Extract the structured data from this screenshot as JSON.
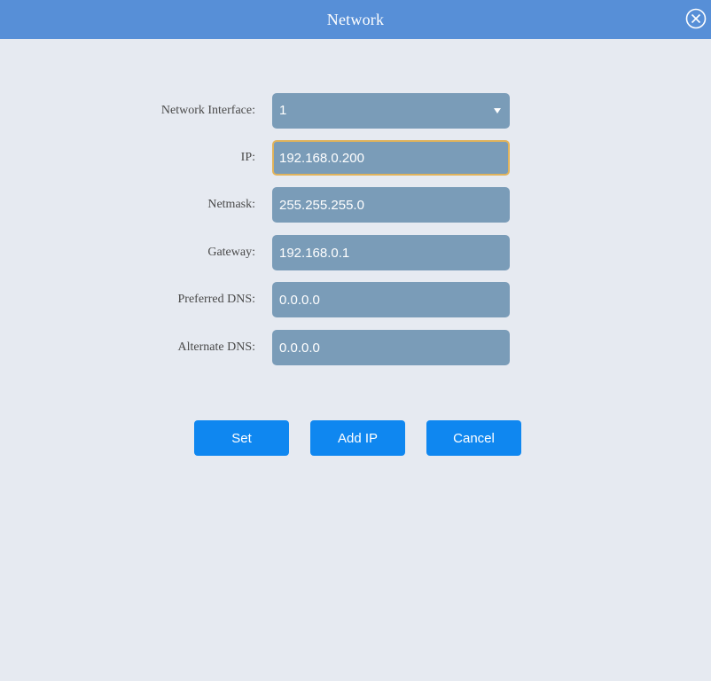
{
  "dialog": {
    "title": "Network"
  },
  "form": {
    "interface": {
      "label": "Network Interface:",
      "value": "1"
    },
    "ip": {
      "label": "IP:",
      "value": "192.168.0.200"
    },
    "netmask": {
      "label": "Netmask:",
      "value": "255.255.255.0"
    },
    "gateway": {
      "label": "Gateway:",
      "value": "192.168.0.1"
    },
    "preferred_dns": {
      "label": "Preferred DNS:",
      "value": "0.0.0.0"
    },
    "alternate_dns": {
      "label": "Alternate DNS:",
      "value": "0.0.0.0"
    }
  },
  "buttons": {
    "set": "Set",
    "add_ip": "Add IP",
    "cancel": "Cancel"
  },
  "icons": {
    "close": "close-circle-icon",
    "dropdown": "caret-down-icon"
  },
  "colors": {
    "titlebar": "#578fd7",
    "background": "#e6eaf1",
    "field": "#7a9cb8",
    "focus_border": "#e0b35c",
    "button": "#0f87f0"
  }
}
